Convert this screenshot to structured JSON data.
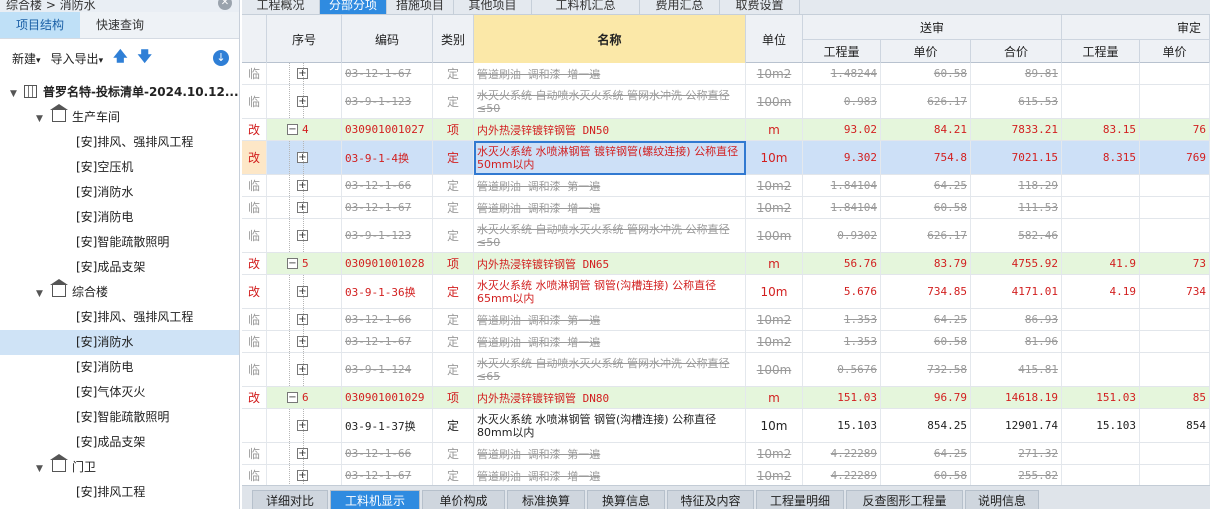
{
  "left_panel": {
    "breadcrumb": "综合楼 > 消防水",
    "tabs": [
      {
        "label": "项目结构",
        "active": true
      },
      {
        "label": "快速查询",
        "active": false
      }
    ],
    "toolbar": {
      "new_label": "新建",
      "import_export_label": "导入导出"
    },
    "tree": [
      {
        "label": "普罗名特-投标清单-2024.10.12...",
        "level": 0,
        "icon": "building-icon",
        "expanded": true
      },
      {
        "label": "生产车间",
        "level": 1,
        "icon": "house-icon",
        "expanded": true
      },
      {
        "label": "[安]排风、强排风工程",
        "level": 2
      },
      {
        "label": "[安]空压机",
        "level": 2
      },
      {
        "label": "[安]消防水",
        "level": 2
      },
      {
        "label": "[安]消防电",
        "level": 2
      },
      {
        "label": "[安]智能疏散照明",
        "level": 2
      },
      {
        "label": "[安]成品支架",
        "level": 2
      },
      {
        "label": "综合楼",
        "level": 1,
        "icon": "house-icon",
        "expanded": true
      },
      {
        "label": "[安]排风、强排风工程",
        "level": 2
      },
      {
        "label": "[安]消防水",
        "level": 2,
        "selected": true
      },
      {
        "label": "[安]消防电",
        "level": 2
      },
      {
        "label": "[安]气体灭火",
        "level": 2
      },
      {
        "label": "[安]智能疏散照明",
        "level": 2
      },
      {
        "label": "[安]成品支架",
        "level": 2
      },
      {
        "label": "门卫",
        "level": 1,
        "icon": "house-icon",
        "expanded": true
      },
      {
        "label": "[安]排风工程",
        "level": 2
      }
    ]
  },
  "top_tabs": [
    {
      "label": "工程概况"
    },
    {
      "label": "分部分项",
      "active": true
    },
    {
      "label": "措施项目"
    },
    {
      "label": "其他项目"
    },
    {
      "label": "工料机汇总"
    },
    {
      "label": "费用汇总"
    },
    {
      "label": "取费设置"
    }
  ],
  "grid_header": {
    "seq": "序号",
    "code": "编码",
    "type": "类别",
    "name": "名称",
    "unit": "单位",
    "group_sent": "送审",
    "group_approved": "审定",
    "qty": "工程量",
    "price": "单价",
    "total": "合价"
  },
  "rows": [
    {
      "tag": "临",
      "code": "03-12-1-67",
      "type": "定",
      "name": "管道刷油 调和漆 增一遍",
      "unit": "10m2",
      "qty": "1.48244",
      "price": "60.58",
      "total": "89.81",
      "style": "strike"
    },
    {
      "tag": "临",
      "code": "03-9-1-123",
      "type": "定",
      "name": "水灭火系统 自动喷水灭火系统 管网水冲洗 公称直径≤50",
      "unit": "100m",
      "qty": "0.983",
      "price": "626.17",
      "total": "615.53",
      "style": "strike",
      "tall": true
    },
    {
      "tag": "改",
      "seq": "4",
      "code": "030901001027",
      "type": "项",
      "name": "内外热浸锌镀锌钢管 DN50",
      "unit": "m",
      "qty": "93.02",
      "price": "84.21",
      "total": "7833.21",
      "aqty": "83.15",
      "aprice": "76",
      "style": "list"
    },
    {
      "tag": "改",
      "code": "03-9-1-4换",
      "type": "定",
      "name": "水灭火系统 水喷淋钢管 镀锌钢管(螺纹连接) 公称直径50mm以内",
      "unit": "10m",
      "qty": "9.302",
      "price": "754.8",
      "total": "7021.15",
      "aqty": "8.315",
      "aprice": "769",
      "style": "selected",
      "tall": true
    },
    {
      "tag": "临",
      "code": "03-12-1-66",
      "type": "定",
      "name": "管道刷油 调和漆 第一遍",
      "unit": "10m2",
      "qty": "1.84104",
      "price": "64.25",
      "total": "118.29",
      "style": "strike"
    },
    {
      "tag": "临",
      "code": "03-12-1-67",
      "type": "定",
      "name": "管道刷油 调和漆 增一遍",
      "unit": "10m2",
      "qty": "1.84104",
      "price": "60.58",
      "total": "111.53",
      "style": "strike"
    },
    {
      "tag": "临",
      "code": "03-9-1-123",
      "type": "定",
      "name": "水灭火系统 自动喷水灭火系统 管网水冲洗 公称直径≤50",
      "unit": "100m",
      "qty": "0.9302",
      "price": "626.17",
      "total": "582.46",
      "style": "strike",
      "tall": true
    },
    {
      "tag": "改",
      "seq": "5",
      "code": "030901001028",
      "type": "项",
      "name": "内外热浸锌镀锌钢管 DN65",
      "unit": "m",
      "qty": "56.76",
      "price": "83.79",
      "total": "4755.92",
      "aqty": "41.9",
      "aprice": "73",
      "style": "list"
    },
    {
      "tag": "改",
      "code": "03-9-1-36换",
      "type": "定",
      "name": "水灭火系统 水喷淋钢管 钢管(沟槽连接) 公称直径65mm以内",
      "unit": "10m",
      "qty": "5.676",
      "price": "734.85",
      "total": "4171.01",
      "aqty": "4.19",
      "aprice": "734",
      "style": "mod",
      "tall": true
    },
    {
      "tag": "临",
      "code": "03-12-1-66",
      "type": "定",
      "name": "管道刷油 调和漆 第一遍",
      "unit": "10m2",
      "qty": "1.353",
      "price": "64.25",
      "total": "86.93",
      "style": "strike"
    },
    {
      "tag": "临",
      "code": "03-12-1-67",
      "type": "定",
      "name": "管道刷油 调和漆 增一遍",
      "unit": "10m2",
      "qty": "1.353",
      "price": "60.58",
      "total": "81.96",
      "style": "strike"
    },
    {
      "tag": "临",
      "code": "03-9-1-124",
      "type": "定",
      "name": "水灭火系统 自动喷水灭火系统 管网水冲洗 公称直径≤65",
      "unit": "100m",
      "qty": "0.5676",
      "price": "732.58",
      "total": "415.81",
      "style": "strike",
      "tall": true
    },
    {
      "tag": "改",
      "seq": "6",
      "code": "030901001029",
      "type": "项",
      "name": "内外热浸锌镀锌钢管 DN80",
      "unit": "m",
      "qty": "151.03",
      "price": "96.79",
      "total": "14618.19",
      "aqty": "151.03",
      "aprice": "85",
      "style": "list"
    },
    {
      "tag": "",
      "code": "03-9-1-37换",
      "type": "定",
      "name": "水灭火系统 水喷淋钢管 钢管(沟槽连接) 公称直径80mm以内",
      "unit": "10m",
      "qty": "15.103",
      "price": "854.25",
      "total": "12901.74",
      "aqty": "15.103",
      "aprice": "854",
      "style": "normal",
      "tall": true
    },
    {
      "tag": "临",
      "code": "03-12-1-66",
      "type": "定",
      "name": "管道刷油 调和漆 第一遍",
      "unit": "10m2",
      "qty": "4.22289",
      "price": "64.25",
      "total": "271.32",
      "style": "strike"
    },
    {
      "tag": "临",
      "code": "03-12-1-67",
      "type": "定",
      "name": "管道刷油 调和漆 增一遍",
      "unit": "10m2",
      "qty": "4.22289",
      "price": "60.58",
      "total": "255.82",
      "style": "strike"
    }
  ],
  "bottom_tabs": [
    {
      "label": "详细对比"
    },
    {
      "label": "工料机显示",
      "active": true
    },
    {
      "label": "单价构成"
    },
    {
      "label": "标准换算"
    },
    {
      "label": "换算信息"
    },
    {
      "label": "特征及内容"
    },
    {
      "label": "工程量明细"
    },
    {
      "label": "反查图形工程量"
    },
    {
      "label": "说明信息"
    }
  ],
  "colors": {
    "accent": "#2f8be0",
    "list_row": "#e5f6dc",
    "name_header": "#fbe8a8",
    "red": "#d21f1f"
  }
}
